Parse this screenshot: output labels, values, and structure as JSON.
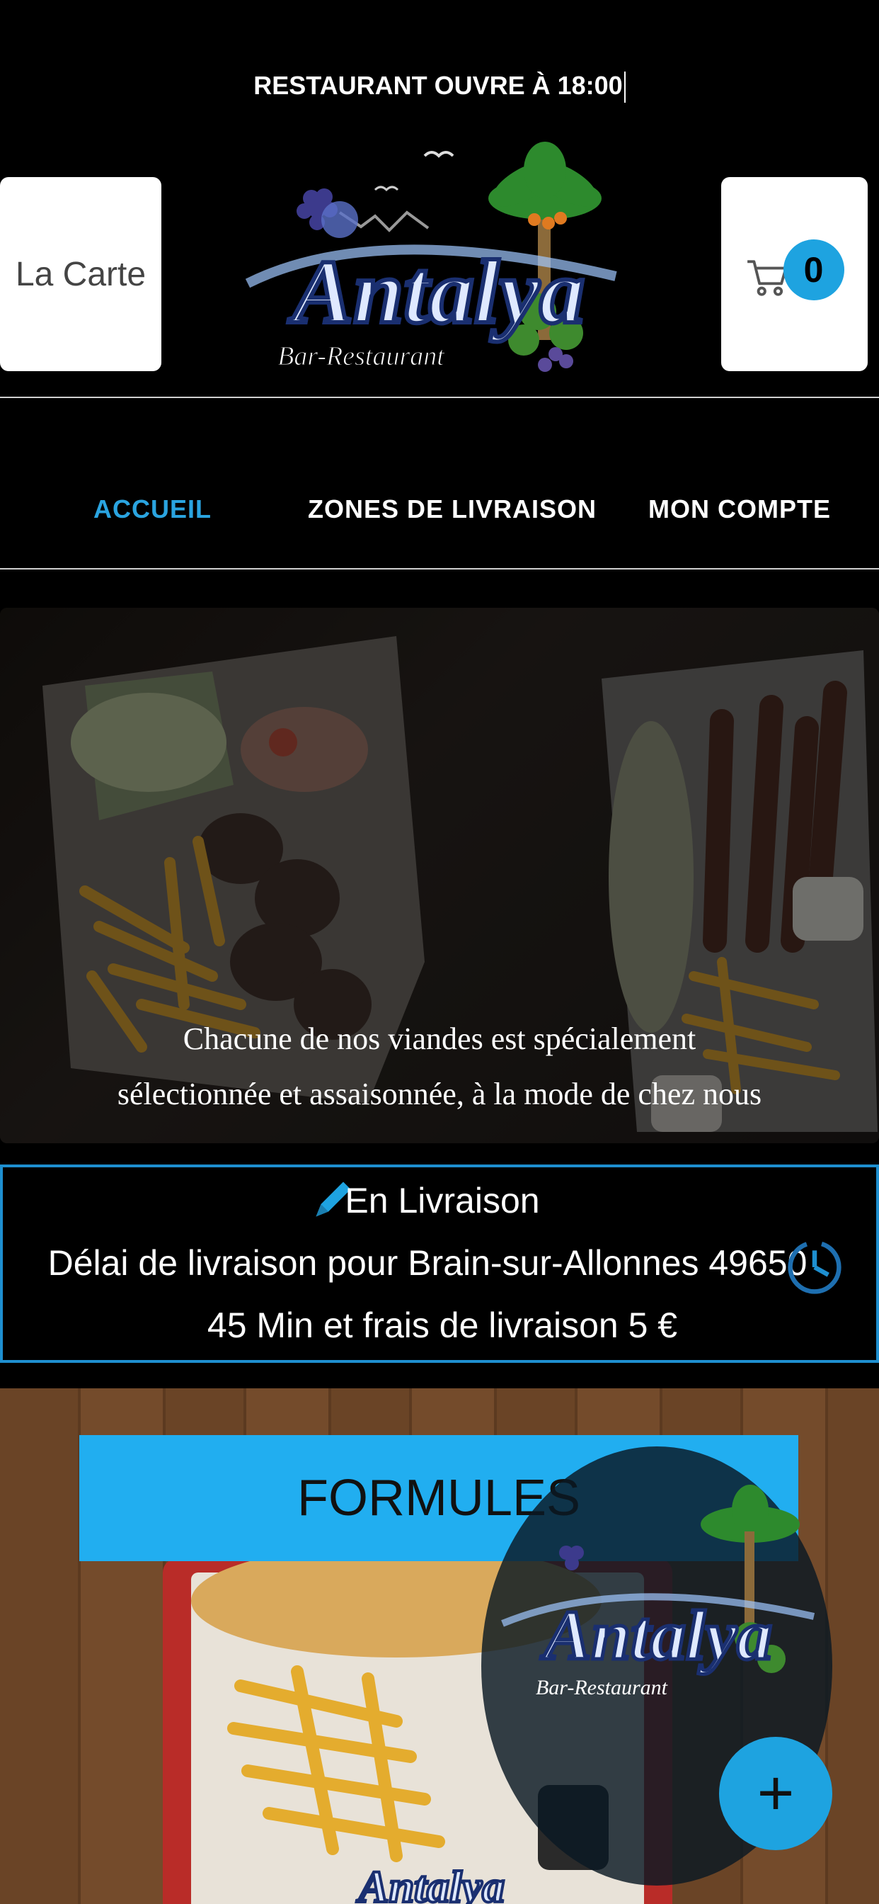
{
  "header": {
    "notice": "RESTAURANT OUVRE À 18:00",
    "menu_button_label": "La Carte",
    "cart_count": "0",
    "logo": {
      "title": "Antalya",
      "subtitle": "Bar-Restaurant"
    }
  },
  "nav": {
    "items": [
      {
        "label": "ACCUEIL",
        "active": true
      },
      {
        "label": "ZONES DE LIVRAISON",
        "active": false
      },
      {
        "label": "MON COMPTE",
        "active": false
      }
    ]
  },
  "hero": {
    "caption_line1": "Chacune de nos viandes est spécialement",
    "caption_line2": "sélectionnée et assaisonnée, à la mode de chez nous"
  },
  "delivery": {
    "title": "En Livraison",
    "line1": "Délai de livraison pour Brain-sur-Allonnes 49650",
    "line2": "45 Min et frais de livraison 5 €",
    "icons": [
      "pencil-icon",
      "clock-icon"
    ]
  },
  "category": {
    "label": "FORMULES"
  },
  "fab": {
    "label": "+"
  },
  "colors": {
    "accent": "#1ea3e0",
    "background": "#000000",
    "banner": "#21aef0"
  }
}
